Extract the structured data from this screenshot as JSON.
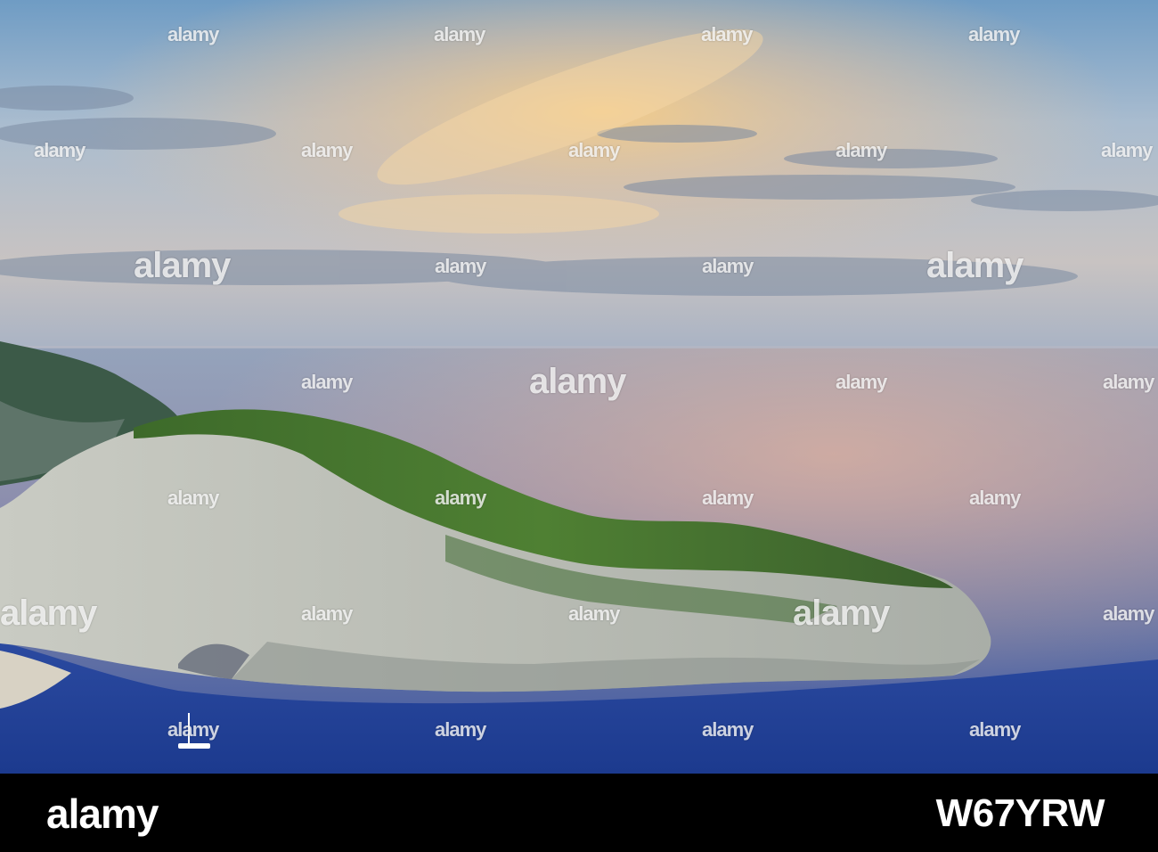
{
  "watermark": {
    "brand": "alamy",
    "colors": {
      "watermark": "#ffffff"
    }
  },
  "footer": {
    "logo_text": "alamy",
    "image_id": "W67YRW",
    "background": "#000000",
    "text_color": "#ffffff"
  },
  "scene": {
    "colors": {
      "sky_top": "#6f9cc4",
      "sky_glow": "#f3c786",
      "sea_far": "#8f9fb9",
      "sea_near": "#22449a",
      "cliff_rock": "#bfc1b9",
      "cliff_forest": "#3f6e2c"
    }
  }
}
